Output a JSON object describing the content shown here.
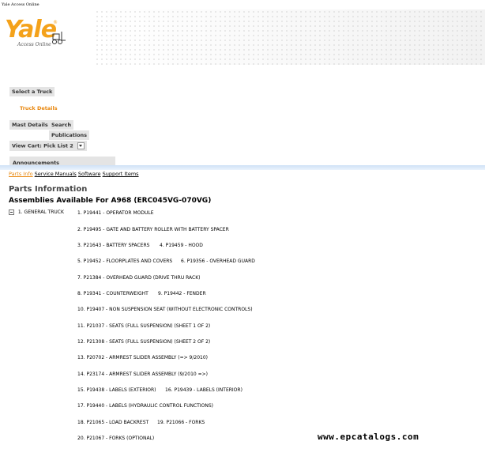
{
  "window_title": "Yale Access Online",
  "brand": {
    "logo_text": "Yale",
    "logo_mark": "®",
    "tagline": "Access Online",
    "accent": "#f4a21b"
  },
  "nav": {
    "select_truck": "Select a Truck",
    "truck_details": "Truck Details",
    "mast_details": "Mast Details",
    "search": "Search",
    "publications": "Publications",
    "view_cart": "View Cart: Pick List 2",
    "announcements": "Announcements"
  },
  "links": {
    "parts_info": "Parts Info",
    "service_manuals": "Service Manuals",
    "software": "Software",
    "support_items": "Support Items"
  },
  "page": {
    "heading": "Parts Information",
    "subheading": "Assemblies Available For A968 (ERC045VG-070VG)"
  },
  "tree": {
    "group": "1. GENERAL TRUCK"
  },
  "assemblies": [
    "1. P19441 - OPERATOR MODULE",
    "2. P19495 - GATE AND BATTERY ROLLER WITH BATTERY SPACER",
    "3. P21643 - BATTERY SPACERS",
    "4. P19459 - HOOD",
    "5. P19452 - FLOORPLATES AND COVERS",
    "6. P19356 - OVERHEAD GUARD",
    "7. P21384 - OVERHEAD GUARD (DRIVE THRU RACK)",
    "8. P19341 - COUNTERWEIGHT",
    "9. P19442 - FENDER",
    "10. P19407 - NON SUSPENSION SEAT (WITHOUT ELECTRONIC CONTROLS)",
    "11. P21037 - SEATS (FULL SUSPENSION) (SHEET 1 OF 2)",
    "12. P21308 - SEATS (FULL SUSPENSION) (SHEET 2 OF 2)",
    "13. P20702 - ARMREST SLIDER ASSEMBLY (=> 9/2010)",
    "14. P23174 - ARMREST SLIDER ASSEMBLY (9/2010 =>)",
    "15. P19438 - LABELS (EXTERIOR)",
    "16. P19439 - LABELS (INTERIOR)",
    "17. P19440 - LABELS (HYDRAULIC CONTROL FUNCTIONS)",
    "18. P21065 - LOAD BACKREST",
    "19. P21066 - FORKS",
    "20. P21067 - FORKS (OPTIONAL)"
  ],
  "watermark": "www.epcatalogs.com"
}
